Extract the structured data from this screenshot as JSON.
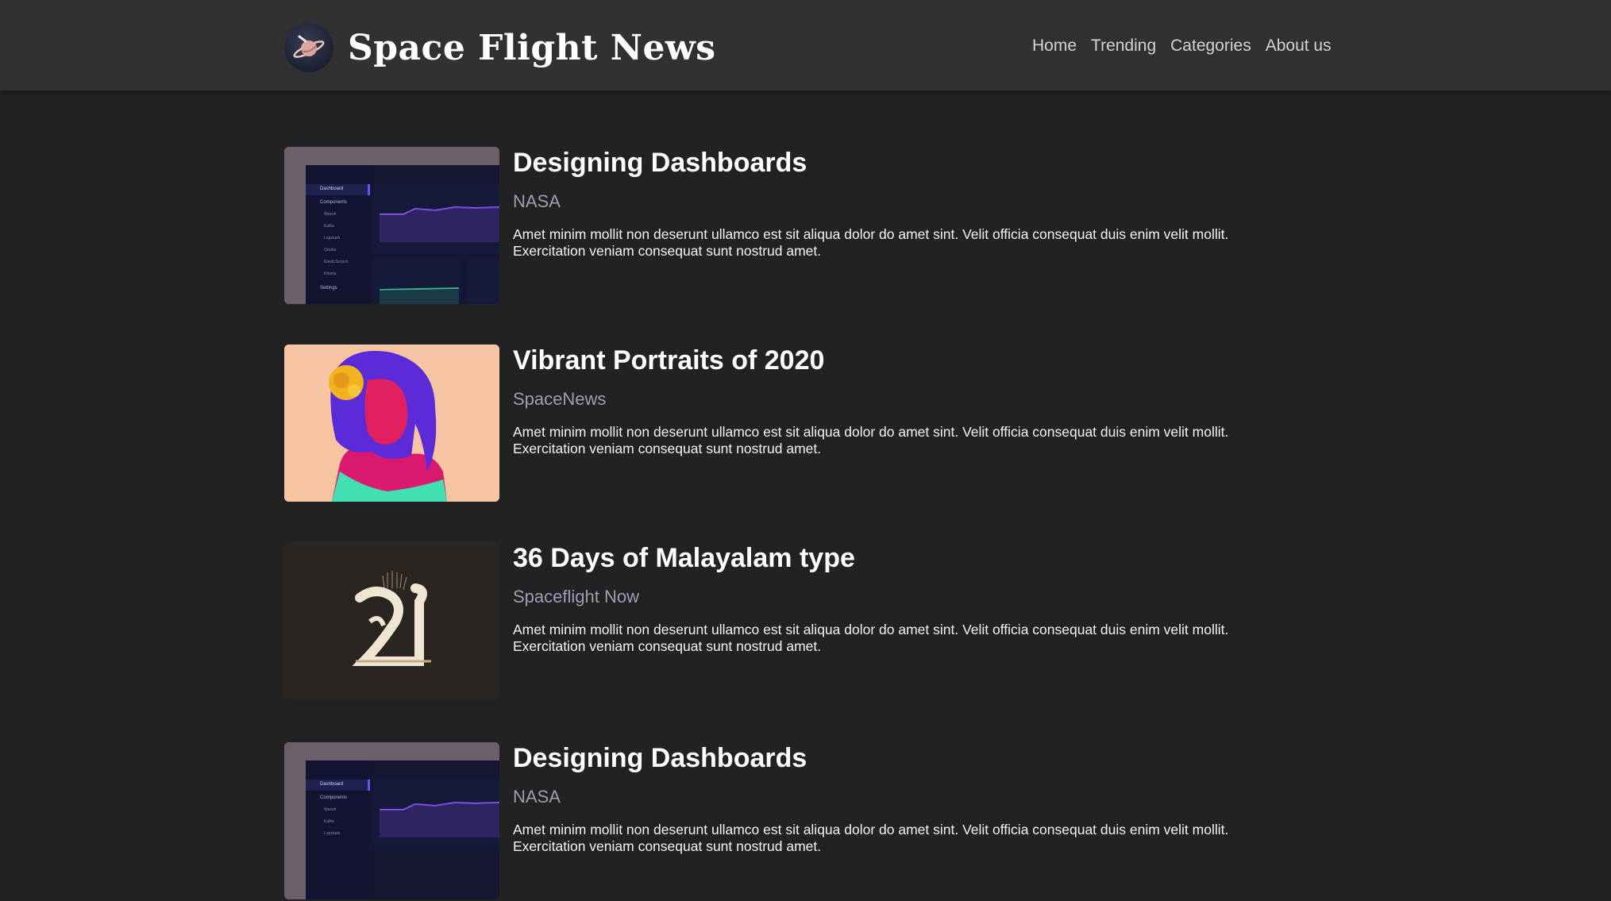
{
  "header": {
    "title": "Space Flight News",
    "logo_icon": "planet-rocket-icon",
    "nav": [
      {
        "label": "Home"
      },
      {
        "label": "Trending"
      },
      {
        "label": "Categories"
      },
      {
        "label": "About us"
      }
    ]
  },
  "posts": [
    {
      "title": "Designing Dashboards",
      "source": "NASA",
      "description": "Amet minim mollit non deserunt ullamco est sit aliqua dolor do amet sint. Velit officia consequat duis enim velit mollit. Exercitation veniam consequat sunt nostrud amet.",
      "thumbnail": "dashboard-screenshot",
      "thumb_labels": [
        "Dashboard",
        "Components",
        "Wazuh",
        "Kafka",
        "Logstash",
        "Qradar",
        "ElasticSearch",
        "Kibana",
        "Settings"
      ]
    },
    {
      "title": "Vibrant Portraits of 2020",
      "source": "SpaceNews",
      "description": "Amet minim mollit non deserunt ullamco est sit aliqua dolor do amet sint. Velit officia consequat duis enim velit mollit. Exercitation veniam consequat sunt nostrud amet.",
      "thumbnail": "portrait-illustration"
    },
    {
      "title": "36 Days of Malayalam type",
      "source": "Spaceflight Now",
      "description": "Amet minim mollit non deserunt ullamco est sit aliqua dolor do amet sint. Velit officia consequat duis enim velit mollit. Exercitation veniam consequat sunt nostrud amet.",
      "thumbnail": "malayalam-letter"
    },
    {
      "title": "Designing Dashboards",
      "source": "NASA",
      "description": "Amet minim mollit non deserunt ullamco est sit aliqua dolor do amet sint. Velit officia consequat duis enim velit mollit. Exercitation veniam consequat sunt nostrud amet.",
      "thumbnail": "dashboard-screenshot",
      "thumb_labels": [
        "Dashboard",
        "Components",
        "Wazuh",
        "Kafka",
        "Logstash"
      ]
    }
  ],
  "colors": {
    "background": "#222222",
    "navbar": "#313131",
    "source_text": "#9c9fb0"
  }
}
